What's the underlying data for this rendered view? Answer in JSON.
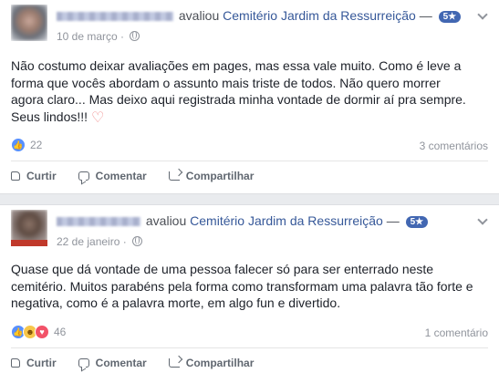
{
  "reviews": [
    {
      "action": "avaliou",
      "page_name": "Cemitério Jardim da Ressurreição",
      "separator": "—",
      "rating": "5★",
      "date": "10 de março",
      "dot": "·",
      "text_lines": [
        "Não costumo deixar avaliações em pages, mas essa vale muito. Como é leve a",
        "forma que vocês abordam o assunto mais triste de todos. Não quero morrer",
        "agora claro... Mas deixo aqui registrada minha vontade de dormir aí pra sempre.",
        "Seus lindos!!!"
      ],
      "emoji": "♡",
      "reaction_count": "22",
      "comments": "3 comentários"
    },
    {
      "action": "avaliou",
      "page_name": "Cemitério Jardim da Ressurreição",
      "separator": "—",
      "rating": "5★",
      "date": "22 de janeiro",
      "dot": "·",
      "text_lines": [
        "Quase que dá vontade de uma pessoa falecer só para ser enterrado neste",
        "cemitério. Muitos parabéns pela forma como transformam uma palavra tão forte e",
        "negativa, como é a palavra morte, em algo fun e divertido."
      ],
      "reaction_count": "46",
      "comments": "1 comentário"
    }
  ],
  "actions": {
    "like": "Curtir",
    "comment": "Comentar",
    "share": "Compartilhar"
  },
  "colors": {
    "link": "#365899",
    "badge": "#4267b2",
    "background": "#e9ebee"
  }
}
